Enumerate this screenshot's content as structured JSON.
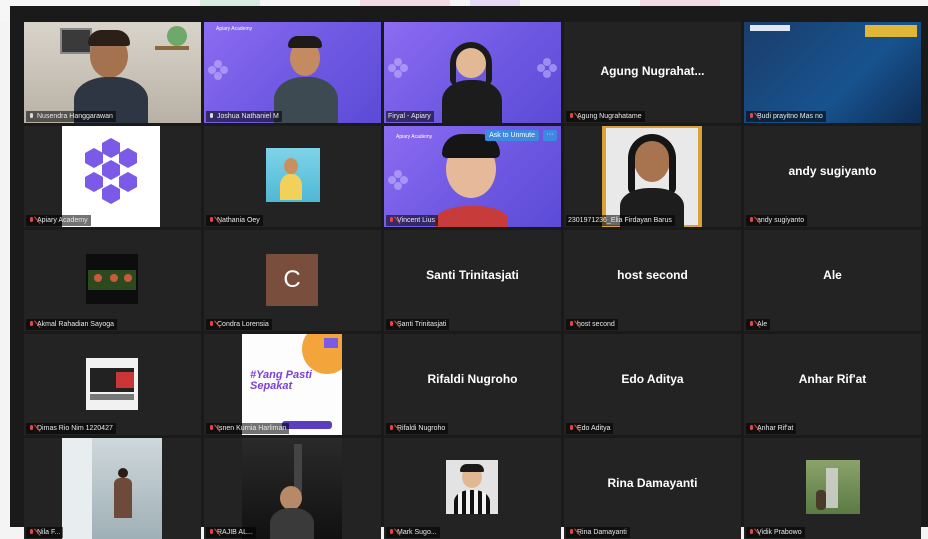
{
  "meeting": {
    "participants": [
      {
        "name": "Nusendra Hanggarawan",
        "muted": false,
        "video": true
      },
      {
        "name": "Joshua Nathaniel M",
        "muted": false,
        "video": true
      },
      {
        "name": "Firyal - Apiary",
        "muted": true,
        "video": true,
        "active_speaker": true
      },
      {
        "name": "Agung Nugrahatame",
        "muted": true,
        "video": false,
        "display_name": "Agung Nugrahat..."
      },
      {
        "name": "Budi prayitno Mas no",
        "muted": true,
        "video": true
      },
      {
        "name": "Apiary Academy",
        "muted": true,
        "video": true
      },
      {
        "name": "Nathania Oey",
        "muted": true,
        "video": true
      },
      {
        "name": "Vincent Lius",
        "muted": true,
        "video": true
      },
      {
        "name": "2301971236_Elia Firdayan Barus",
        "muted": false,
        "video": true
      },
      {
        "name": "andy sugiyanto",
        "muted": true,
        "video": false,
        "display_name": "andy sugiyanto"
      },
      {
        "name": "Akmal Rahadian Sayoga",
        "muted": true,
        "video": true
      },
      {
        "name": "Condra Lorensia",
        "muted": true,
        "video": false,
        "initial": "C"
      },
      {
        "name": "Santi Trinitasjati",
        "muted": true,
        "video": false,
        "display_name": "Santi Trinitasjati"
      },
      {
        "name": "host second",
        "muted": true,
        "video": false,
        "display_name": "host second"
      },
      {
        "name": "Ale",
        "muted": true,
        "video": false,
        "display_name": "Ale"
      },
      {
        "name": "Dimas Rio Nim 1220427",
        "muted": true,
        "video": true
      },
      {
        "name": "Isnen Kurnia Harliman",
        "muted": true,
        "video": true
      },
      {
        "name": "Rifaldi Nugroho",
        "muted": true,
        "video": false,
        "display_name": "Rifaldi Nugroho"
      },
      {
        "name": "Edo Aditya",
        "muted": true,
        "video": false,
        "display_name": "Edo Aditya"
      },
      {
        "name": "Anhar Rif'at",
        "muted": true,
        "video": false,
        "display_name": "Anhar Rif'at"
      },
      {
        "name": "Nila F...",
        "muted": true,
        "video": true
      },
      {
        "name": "RAJIB AL...",
        "muted": true,
        "video": true
      },
      {
        "name": "Mark Sugo...",
        "muted": true,
        "video": true
      },
      {
        "name": "Rina Damayanti",
        "muted": true,
        "video": false,
        "display_name": "Rina Damayanti"
      },
      {
        "name": "Vidik Prabowo",
        "muted": true,
        "video": true
      }
    ]
  },
  "overlays": {
    "ask_to_unmute": "Ask to Unmute",
    "more": "···",
    "brand_small": "Apiary Academy",
    "poster_text": "#Yang Pasti Sepakat"
  },
  "colors": {
    "stage_bg": "#1a1a1a",
    "tile_bg": "#232323",
    "active_border": "#dfe63a",
    "muted_icon": "#e04848",
    "brand_purple": "#7b61ee",
    "unmute_button": "#3d8be0"
  }
}
